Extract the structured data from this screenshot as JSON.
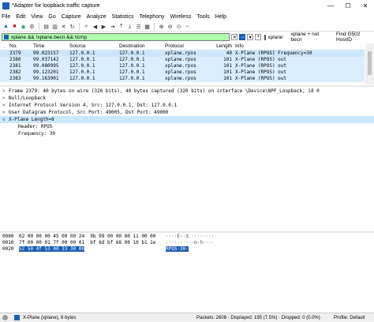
{
  "window": {
    "title": "*Adapter for loopback traffic capture",
    "minimize": "—",
    "maximize": "☐",
    "close": "✕"
  },
  "menu": [
    "File",
    "Edit",
    "View",
    "Go",
    "Capture",
    "Analyze",
    "Statistics",
    "Telephony",
    "Wireless",
    "Tools",
    "Help"
  ],
  "filter": {
    "value": "xplane && !xplane.becn && !icmp",
    "buttons": [
      "xplane",
      "xplane + not becn",
      "Find G502 HostID"
    ]
  },
  "packet_list": {
    "columns": [
      "No.",
      "Time",
      "Source",
      "Destination",
      "Protocol",
      "Length",
      "Info"
    ],
    "rows": [
      [
        "2379",
        "99.023157",
        "127.0.0.1",
        "127.0.0.1",
        "xplane.rpos",
        "40",
        "X-Plane (RPOS) Frequency=30"
      ],
      [
        "2380",
        "99.037142",
        "127.0.0.1",
        "127.0.0.1",
        "xplane.rpos",
        "101",
        "X-Plane (RPOS) out"
      ],
      [
        "2381",
        "99.080995",
        "127.0.0.1",
        "127.0.0.1",
        "xplane.rpos",
        "101",
        "X-Plane (RPOS) out"
      ],
      [
        "2382",
        "99.123201",
        "127.0.0.1",
        "127.0.0.1",
        "xplane.rpos",
        "101",
        "X-Plane (RPOS) out"
      ],
      [
        "2383",
        "99.163901",
        "127.0.0.1",
        "127.0.0.1",
        "xplane.rpos",
        "101",
        "X-Plane (RPOS) out"
      ]
    ]
  },
  "details": [
    {
      "arrow": ">",
      "text": "Frame 2379: 40 bytes on wire (320 bits), 40 bytes captured (320 bits) on interface \\Device\\NPF_Loopback, id 0"
    },
    {
      "arrow": ">",
      "text": "Null/Loopback"
    },
    {
      "arrow": ">",
      "text": "Internet Protocol Version 4, Src: 127.0.0.1, Dst: 127.0.0.1"
    },
    {
      "arrow": ">",
      "text": "User Datagram Protocol, Src Port: 49005, Dst Port: 49000"
    },
    {
      "arrow": "v",
      "text": "X-Plane Length=8"
    },
    {
      "arrow": "",
      "text": "Header: RPOS"
    },
    {
      "arrow": "",
      "text": "Frequency: 30"
    }
  ],
  "bytes": [
    {
      "offset": "0000",
      "hex": "02 00 00 00 45 00 00 24  9b 99 00 00 80 11 00 00",
      "ascii": "····E··$ ········"
    },
    {
      "offset": "0010",
      "hex": "7f 00 00 01 7f 00 00 01  bf 6d bf 68 00 10 b1 1e",
      "ascii": "········ ·m·h····"
    },
    {
      "offset": "0020",
      "hex_hl": "52 50 4f 53 00 33 30 00",
      "ascii_hl": "RPOS·30·"
    }
  ],
  "status": {
    "left": "X-Plane (xplane), 8 bytes",
    "middle": "Packets: 2608 · Displayed: 195 (7.5%) · Dropped: 0 (0.0%)",
    "right": "Profile: Default"
  }
}
